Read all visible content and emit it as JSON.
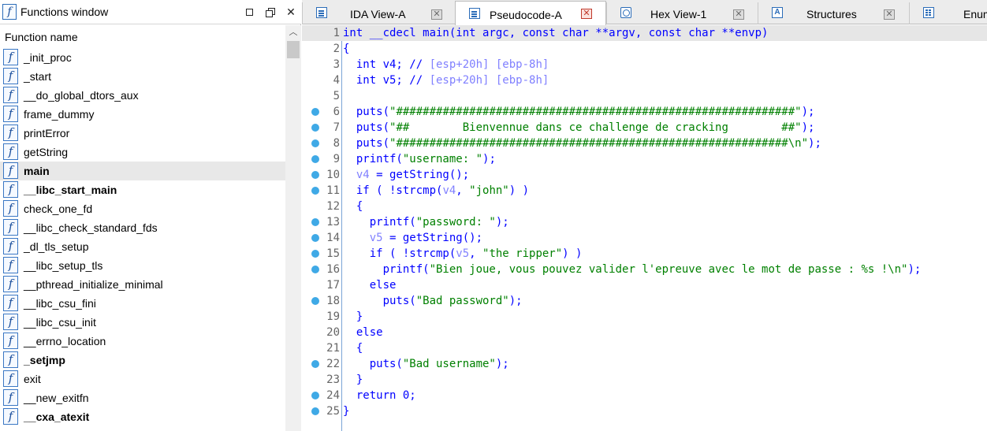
{
  "functions_window": {
    "title": "Functions window",
    "column_header": "Function name",
    "items": [
      {
        "name": "_init_proc",
        "bold": false,
        "selected": false
      },
      {
        "name": "_start",
        "bold": false,
        "selected": false
      },
      {
        "name": "__do_global_dtors_aux",
        "bold": false,
        "selected": false
      },
      {
        "name": "frame_dummy",
        "bold": false,
        "selected": false
      },
      {
        "name": "printError",
        "bold": false,
        "selected": false
      },
      {
        "name": "getString",
        "bold": false,
        "selected": false
      },
      {
        "name": "main",
        "bold": true,
        "selected": true
      },
      {
        "name": "__libc_start_main",
        "bold": true,
        "selected": false
      },
      {
        "name": "check_one_fd",
        "bold": false,
        "selected": false
      },
      {
        "name": "__libc_check_standard_fds",
        "bold": false,
        "selected": false
      },
      {
        "name": "_dl_tls_setup",
        "bold": false,
        "selected": false
      },
      {
        "name": "__libc_setup_tls",
        "bold": false,
        "selected": false
      },
      {
        "name": "__pthread_initialize_minimal",
        "bold": false,
        "selected": false
      },
      {
        "name": "__libc_csu_fini",
        "bold": false,
        "selected": false
      },
      {
        "name": "__libc_csu_init",
        "bold": false,
        "selected": false
      },
      {
        "name": "__errno_location",
        "bold": false,
        "selected": false
      },
      {
        "name": "_setjmp",
        "bold": true,
        "selected": false
      },
      {
        "name": "exit",
        "bold": false,
        "selected": false
      },
      {
        "name": "__new_exitfn",
        "bold": false,
        "selected": false
      },
      {
        "name": "__cxa_atexit",
        "bold": true,
        "selected": false
      }
    ]
  },
  "tabs": [
    {
      "label": "IDA View-A",
      "icon": "document-icon",
      "active": false
    },
    {
      "label": "Pseudocode-A",
      "icon": "document-icon",
      "active": true
    },
    {
      "label": "Hex View-1",
      "icon": "hex-view-icon",
      "active": false
    },
    {
      "label": "Structures",
      "icon": "structures-icon",
      "icon_glyph": "A",
      "active": false
    },
    {
      "label": "Enum",
      "icon": "enums-icon",
      "active": false
    }
  ],
  "pseudocode": {
    "lines": [
      {
        "n": "1",
        "bp": false,
        "current": true,
        "parts": [
          [
            "k",
            "int __cdecl main(int argc, const char **argv, const char **envp)"
          ]
        ]
      },
      {
        "n": "2",
        "bp": false,
        "parts": [
          [
            "k",
            "{"
          ]
        ]
      },
      {
        "n": "3",
        "bp": false,
        "parts": [
          [
            "k",
            "  int v4; // "
          ],
          [
            "c",
            "[esp+20h] [ebp-8h]"
          ]
        ]
      },
      {
        "n": "4",
        "bp": false,
        "parts": [
          [
            "k",
            "  int v5; // "
          ],
          [
            "c",
            "[esp+20h] [ebp-8h]"
          ]
        ]
      },
      {
        "n": "5",
        "bp": false,
        "parts": []
      },
      {
        "n": "6",
        "bp": true,
        "parts": [
          [
            "k",
            "  puts("
          ],
          [
            "s",
            "\"############################################################\""
          ],
          [
            "k",
            ");"
          ]
        ]
      },
      {
        "n": "7",
        "bp": true,
        "parts": [
          [
            "k",
            "  puts("
          ],
          [
            "s",
            "\"##        Bienvennue dans ce challenge de cracking        ##\""
          ],
          [
            "k",
            ");"
          ]
        ]
      },
      {
        "n": "8",
        "bp": true,
        "parts": [
          [
            "k",
            "  puts("
          ],
          [
            "s",
            "\"###########################################################\\n\""
          ],
          [
            "k",
            ");"
          ]
        ]
      },
      {
        "n": "9",
        "bp": true,
        "parts": [
          [
            "k",
            "  printf("
          ],
          [
            "s",
            "\"username: \""
          ],
          [
            "k",
            ");"
          ]
        ]
      },
      {
        "n": "10",
        "bp": true,
        "parts": [
          [
            "k",
            "  "
          ],
          [
            "v",
            "v4"
          ],
          [
            "k",
            " = getString();"
          ]
        ]
      },
      {
        "n": "11",
        "bp": true,
        "parts": [
          [
            "k",
            "  if ( !strcmp("
          ],
          [
            "v",
            "v4"
          ],
          [
            "k",
            ", "
          ],
          [
            "s",
            "\"john\""
          ],
          [
            "k",
            ") )"
          ]
        ]
      },
      {
        "n": "12",
        "bp": false,
        "parts": [
          [
            "k",
            "  {"
          ]
        ]
      },
      {
        "n": "13",
        "bp": true,
        "parts": [
          [
            "k",
            "    printf("
          ],
          [
            "s",
            "\"password: \""
          ],
          [
            "k",
            ");"
          ]
        ]
      },
      {
        "n": "14",
        "bp": true,
        "parts": [
          [
            "k",
            "    "
          ],
          [
            "v",
            "v5"
          ],
          [
            "k",
            " = getString();"
          ]
        ]
      },
      {
        "n": "15",
        "bp": true,
        "parts": [
          [
            "k",
            "    if ( !strcmp("
          ],
          [
            "v",
            "v5"
          ],
          [
            "k",
            ", "
          ],
          [
            "s",
            "\"the ripper\""
          ],
          [
            "k",
            ") )"
          ]
        ]
      },
      {
        "n": "16",
        "bp": true,
        "parts": [
          [
            "k",
            "      printf("
          ],
          [
            "s",
            "\"Bien joue, vous pouvez valider l'epreuve avec le mot de passe : %s !\\n\""
          ],
          [
            "k",
            ");"
          ]
        ]
      },
      {
        "n": "17",
        "bp": false,
        "parts": [
          [
            "k",
            "    else"
          ]
        ]
      },
      {
        "n": "18",
        "bp": true,
        "parts": [
          [
            "k",
            "      puts("
          ],
          [
            "s",
            "\"Bad password\""
          ],
          [
            "k",
            ");"
          ]
        ]
      },
      {
        "n": "19",
        "bp": false,
        "parts": [
          [
            "k",
            "  }"
          ]
        ]
      },
      {
        "n": "20",
        "bp": false,
        "parts": [
          [
            "k",
            "  else"
          ]
        ]
      },
      {
        "n": "21",
        "bp": false,
        "parts": [
          [
            "k",
            "  {"
          ]
        ]
      },
      {
        "n": "22",
        "bp": true,
        "parts": [
          [
            "k",
            "    puts("
          ],
          [
            "s",
            "\"Bad username\""
          ],
          [
            "k",
            ");"
          ]
        ]
      },
      {
        "n": "23",
        "bp": false,
        "parts": [
          [
            "k",
            "  }"
          ]
        ]
      },
      {
        "n": "24",
        "bp": true,
        "parts": [
          [
            "k",
            "  return 0;"
          ]
        ]
      },
      {
        "n": "25",
        "bp": true,
        "parts": [
          [
            "k",
            "}"
          ]
        ]
      }
    ]
  },
  "colors": {
    "keyword": "#0000ff",
    "string": "#008000",
    "comment": "#8080ff",
    "variable": "#8080ff",
    "breakpoint": "#3fa9e6",
    "line_number": "#666666"
  }
}
